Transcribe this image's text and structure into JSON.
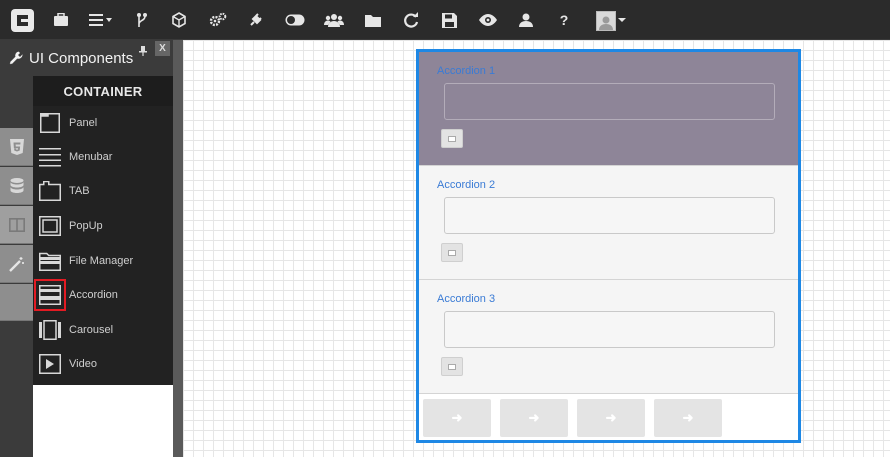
{
  "toolbar": {
    "icons": [
      "logo-icon",
      "briefcase-icon",
      "menu-icon",
      "branch-icon",
      "cube-icon",
      "cogs-icon",
      "plug-icon",
      "toggle-icon",
      "users-icon",
      "folder-icon",
      "refresh-icon",
      "save-icon",
      "eye-icon",
      "user-icon",
      "help-icon",
      "avatar-icon"
    ],
    "help_label": "?"
  },
  "sidebar_tabs": [
    "html5-icon",
    "database-icon",
    "layout-icon",
    "magic-icon"
  ],
  "panel": {
    "title": "UI Components",
    "close_label": "X",
    "section": "CONTAINER",
    "items": [
      {
        "label": "Panel",
        "icon": "panel-icon"
      },
      {
        "label": "Menubar",
        "icon": "menubar-icon"
      },
      {
        "label": "TAB",
        "icon": "tab-icon"
      },
      {
        "label": "PopUp",
        "icon": "popup-icon"
      },
      {
        "label": "File Manager",
        "icon": "file-manager-icon"
      },
      {
        "label": "Accordion",
        "icon": "accordion-icon",
        "selected": true
      },
      {
        "label": "Carousel",
        "icon": "carousel-icon"
      },
      {
        "label": "Video",
        "icon": "video-icon"
      }
    ]
  },
  "accordion": {
    "panels": [
      {
        "title": "Accordion 1",
        "active": true
      },
      {
        "title": "Accordion 2",
        "active": false
      },
      {
        "title": "Accordion 3",
        "active": false
      }
    ],
    "nav_buttons": 4
  },
  "colors": {
    "toolbar_bg": "#2b2b2b",
    "selection_border": "#1e88e5",
    "active_panel": "#8e8598",
    "title_link": "#3a7bd5",
    "selected_marker": "#e31b23"
  }
}
